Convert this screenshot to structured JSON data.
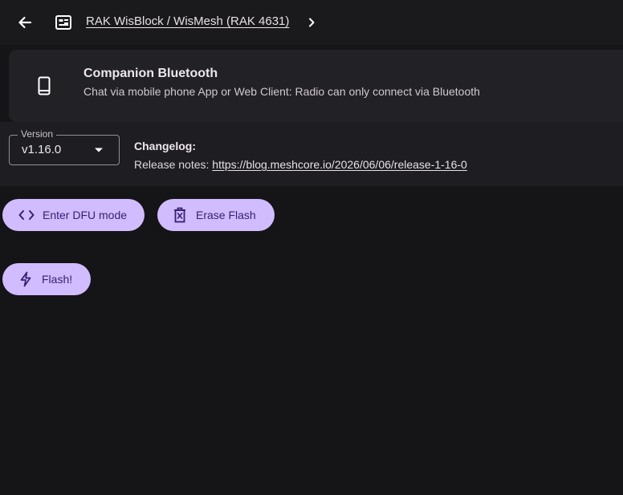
{
  "header": {
    "breadcrumb": "RAK WisBlock / WisMesh (RAK 4631)",
    "icons": {
      "back": "arrow-left-icon",
      "device": "device-board-icon",
      "next": "chevron-right-icon"
    }
  },
  "firmware_card": {
    "title": "Companion Bluetooth",
    "subtitle": "Chat via mobile phone App or Web Client: Radio can only connect via Bluetooth",
    "icon": "smartphone-icon"
  },
  "version": {
    "label": "Version",
    "selected": "v1.16.0"
  },
  "changelog": {
    "title": "Changelog:",
    "release_prefix": "Release notes: ",
    "release_url": "https://blog.meshcore.io/2026/06/06/release-1-16-0"
  },
  "actions": {
    "dfu_label": "Enter DFU mode",
    "erase_label": "Erase Flash",
    "flash_label": "Flash!"
  },
  "colors": {
    "background": "#151417",
    "card": "#222125",
    "button": "#d0bcff",
    "button_text": "#381e72"
  }
}
